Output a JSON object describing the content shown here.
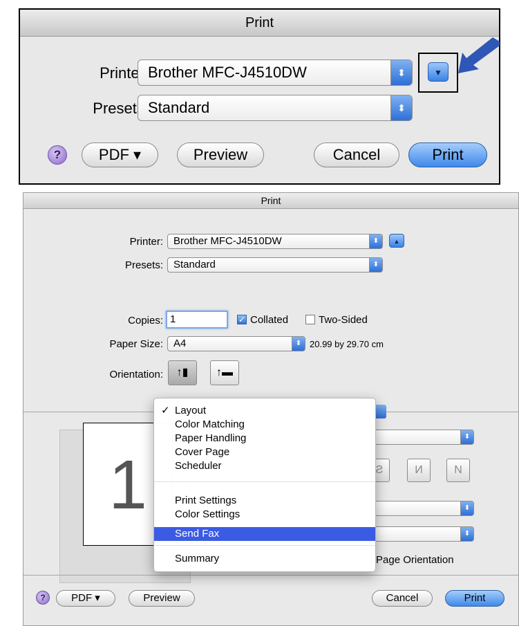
{
  "dialog1": {
    "title": "Print",
    "printer_label": "Printer:",
    "printer_value": "Brother MFC-J4510DW",
    "presets_label": "Presets:",
    "presets_value": "Standard",
    "help": "?",
    "pdf_label": "PDF ▾",
    "preview_label": "Preview",
    "cancel_label": "Cancel",
    "print_label": "Print",
    "expand_glyph": "▼",
    "arrow_color": "#2f57b7"
  },
  "dialog2": {
    "title": "Print",
    "printer_label": "Printer:",
    "printer_value": "Brother MFC-J4510DW",
    "presets_label": "Presets:",
    "presets_value": "Standard",
    "copies_label": "Copies:",
    "copies_value": "1",
    "collated_label": "Collated",
    "twosided_label": "Two-Sided",
    "papersize_label": "Paper Size:",
    "papersize_value": "A4",
    "papersize_dims": "20.99 by 29.70 cm",
    "orientation_label": "Orientation:",
    "preview_page": "1",
    "page_orientation": "Page Orientation",
    "help": "?",
    "pdf_label": "PDF ▾",
    "preview_label": "Preview",
    "cancel_label": "Cancel",
    "print_label": "Print",
    "collapse_glyph": "▲"
  },
  "menu": {
    "items": [
      {
        "label": "Layout",
        "checked": true
      },
      {
        "label": "Color Matching"
      },
      {
        "label": "Paper Handling"
      },
      {
        "label": "Cover Page"
      },
      {
        "label": "Scheduler"
      },
      {
        "label": "Print Settings"
      },
      {
        "label": "Color Settings"
      },
      {
        "label": "Send Fax",
        "highlighted": true
      },
      {
        "label": "Summary"
      }
    ],
    "check_glyph": "✓",
    "highlight_color": "#3b5be3"
  }
}
